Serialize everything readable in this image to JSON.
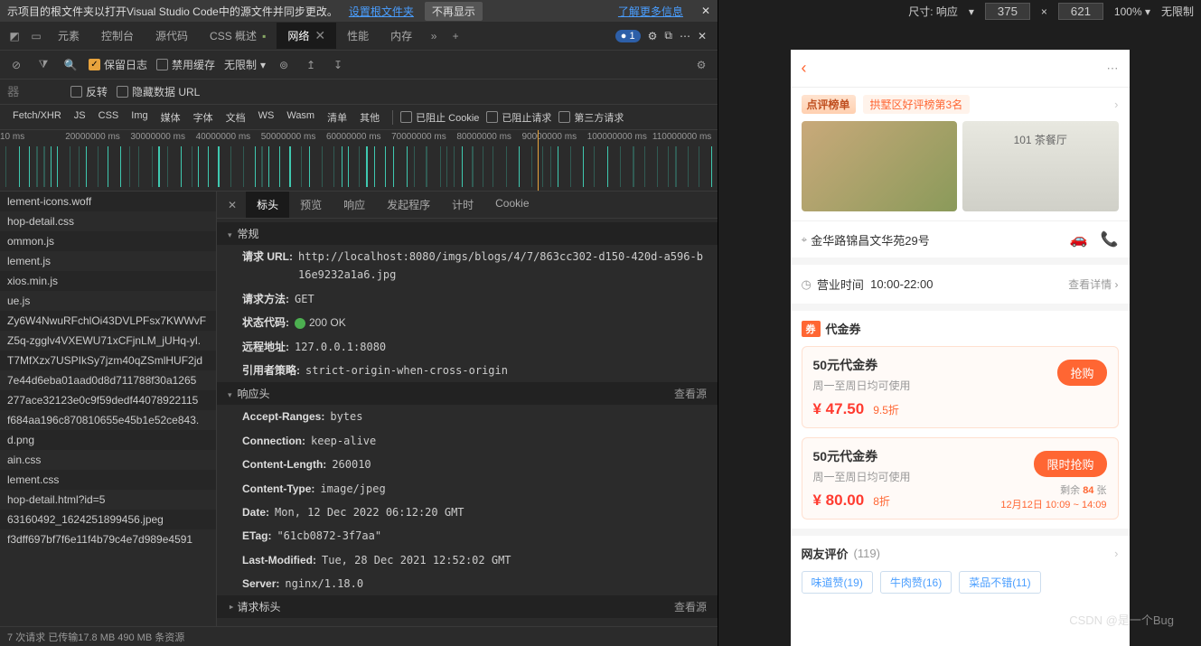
{
  "info_bar": {
    "text": "示项目的根文件夹以打开Visual Studio Code中的源文件并同步更改。",
    "set_root": "设置根文件夹",
    "hide": "不再显示",
    "learn_more": "了解更多信息"
  },
  "tabs": [
    "元素",
    "控制台",
    "源代码",
    "CSS 概述",
    "网络",
    "性能",
    "内存"
  ],
  "active_tab": 4,
  "issues_badge": "1",
  "toolbar": {
    "preserve_log": "保留日志",
    "disable_cache": "禁用缓存",
    "throttle": "无限制"
  },
  "filter_bar": {
    "placeholder": "器",
    "invert": "反转",
    "hide_data": "隐藏数据 URL"
  },
  "types": [
    "Fetch/XHR",
    "JS",
    "CSS",
    "Img",
    "媒体",
    "字体",
    "文档",
    "WS",
    "Wasm",
    "清单",
    "其他"
  ],
  "type_checks": [
    "已阻止 Cookie",
    "已阻止请求",
    "第三方请求"
  ],
  "timeline_labels": [
    "10 ms",
    "20000000 ms",
    "30000000 ms",
    "40000000 ms",
    "50000000 ms",
    "60000000 ms",
    "70000000 ms",
    "80000000 ms",
    "90000000 ms",
    "100000000 ms",
    "110000000 ms"
  ],
  "requests": [
    "lement-icons.woff",
    "hop-detail.css",
    "ommon.js",
    "lement.js",
    "xios.min.js",
    "ue.js",
    "Zy6W4NwuRFchlOi43DVLPFsx7KWWvF",
    "Z5q-zgglv4VXEWU71xCFjnLM_jUHq-yl.",
    "T7MfXzx7USPIkSy7jzm40qZSmlHUF2jd",
    "7e44d6eba01aad0d8d711788f30a1265",
    "277ace32123e0c9f59dedf44078922115",
    "f684aa196c870810655e45b1e52ce843.",
    "d.png",
    "ain.css",
    "lement.css",
    "hop-detail.html?id=5",
    "63160492_1624251899456.jpeg",
    "f3dff697bf7f6e11f4b79c4e7d989e4591"
  ],
  "detail_tabs": [
    "标头",
    "预览",
    "响应",
    "发起程序",
    "计时",
    "Cookie"
  ],
  "sections": {
    "general": "常规",
    "response": "响应头",
    "request": "请求标头",
    "view_source": "查看源"
  },
  "general": {
    "url_k": "请求 URL:",
    "url_v": "http://localhost:8080/imgs/blogs/4/7/863cc302-d150-420d-a596-b16e9232a1a6.jpg",
    "method_k": "请求方法:",
    "method_v": "GET",
    "status_k": "状态代码:",
    "status_v": "200 OK",
    "remote_k": "远程地址:",
    "remote_v": "127.0.0.1:8080",
    "referrer_k": "引用者策略:",
    "referrer_v": "strict-origin-when-cross-origin"
  },
  "response_headers": [
    {
      "k": "Accept-Ranges:",
      "v": "bytes"
    },
    {
      "k": "Connection:",
      "v": "keep-alive"
    },
    {
      "k": "Content-Length:",
      "v": "260010"
    },
    {
      "k": "Content-Type:",
      "v": "image/jpeg"
    },
    {
      "k": "Date:",
      "v": "Mon, 12 Dec 2022 06:12:20 GMT"
    },
    {
      "k": "ETag:",
      "v": "\"61cb0872-3f7aa\""
    },
    {
      "k": "Last-Modified:",
      "v": "Tue, 28 Dec 2021 12:52:02 GMT"
    },
    {
      "k": "Server:",
      "v": "nginx/1.18.0"
    }
  ],
  "status_summary": "7 次请求  已传输17.8 MB  490 MB 条资源",
  "preview_header": {
    "size_label": "尺寸: 响应",
    "w": "375",
    "h": "621",
    "zoom": "100%",
    "throttle": "无限制"
  },
  "phone": {
    "rank_badge": "点评榜单",
    "rank_text": "拱墅区好评榜第3名",
    "img2_label": "101 茶餐厅",
    "address": "金华路锦昌文华苑29号",
    "hours_label": "营业时间",
    "hours_value": "10:00-22:00",
    "view_detail": "查看详情",
    "voucher_section": "代金券",
    "coupons": [
      {
        "title": "50元代金券",
        "desc": "周一至周日均可使用",
        "price": "¥ 47.50",
        "discount": "9.5折",
        "btn": "抢购",
        "extra": ""
      },
      {
        "title": "50元代金券",
        "desc": "周一至周日均可使用",
        "price": "¥ 80.00",
        "discount": "8折",
        "btn": "限时抢购",
        "stock": "剩余 84 张",
        "time": "12月12日 10:09 ~ 14:09"
      }
    ],
    "reviews_title": "网友评价",
    "reviews_count": "(119)",
    "review_tags": [
      "味道赞(19)",
      "牛肉赞(16)",
      "菜品不错(11)"
    ]
  },
  "watermark": "CSDN @是一个Bug"
}
